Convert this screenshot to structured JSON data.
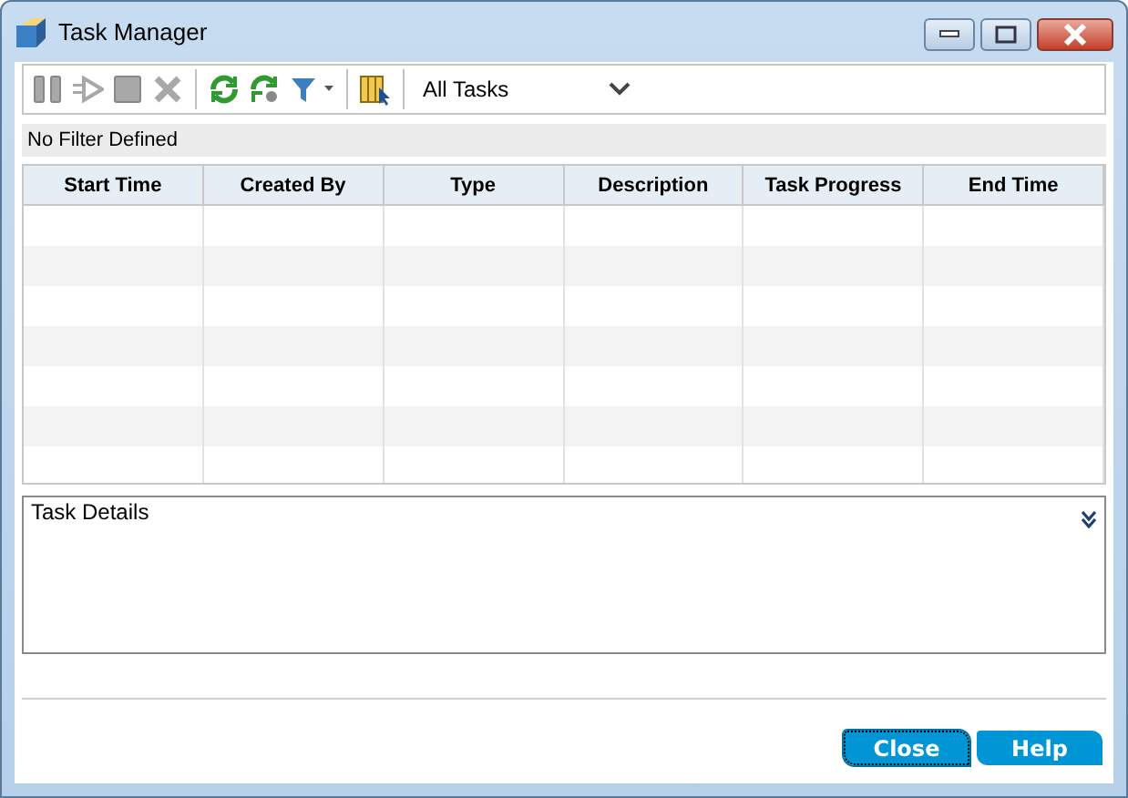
{
  "window": {
    "title": "Task Manager"
  },
  "toolbar": {
    "tools": [
      {
        "kind": "pause",
        "disabled": true
      },
      {
        "kind": "resume",
        "disabled": true
      },
      {
        "kind": "stop",
        "disabled": true
      },
      {
        "kind": "delete",
        "disabled": true
      },
      {
        "kind": "sep"
      },
      {
        "kind": "refresh",
        "disabled": false
      },
      {
        "kind": "auto-refresh",
        "disabled": false
      },
      {
        "kind": "filter",
        "disabled": false
      },
      {
        "kind": "sep"
      },
      {
        "kind": "columns",
        "disabled": false
      },
      {
        "kind": "sep"
      }
    ],
    "task_filter": {
      "value": "All Tasks"
    }
  },
  "filter_status": "No Filter Defined",
  "table": {
    "columns": [
      "Start Time",
      "Created By",
      "Type",
      "Description",
      "Task Progress",
      "End Time"
    ]
  },
  "details": {
    "title": "Task Details",
    "expanded": false
  },
  "buttons": [
    {
      "label": "Close",
      "focused": true
    },
    {
      "label": "Help",
      "focused": false
    }
  ]
}
